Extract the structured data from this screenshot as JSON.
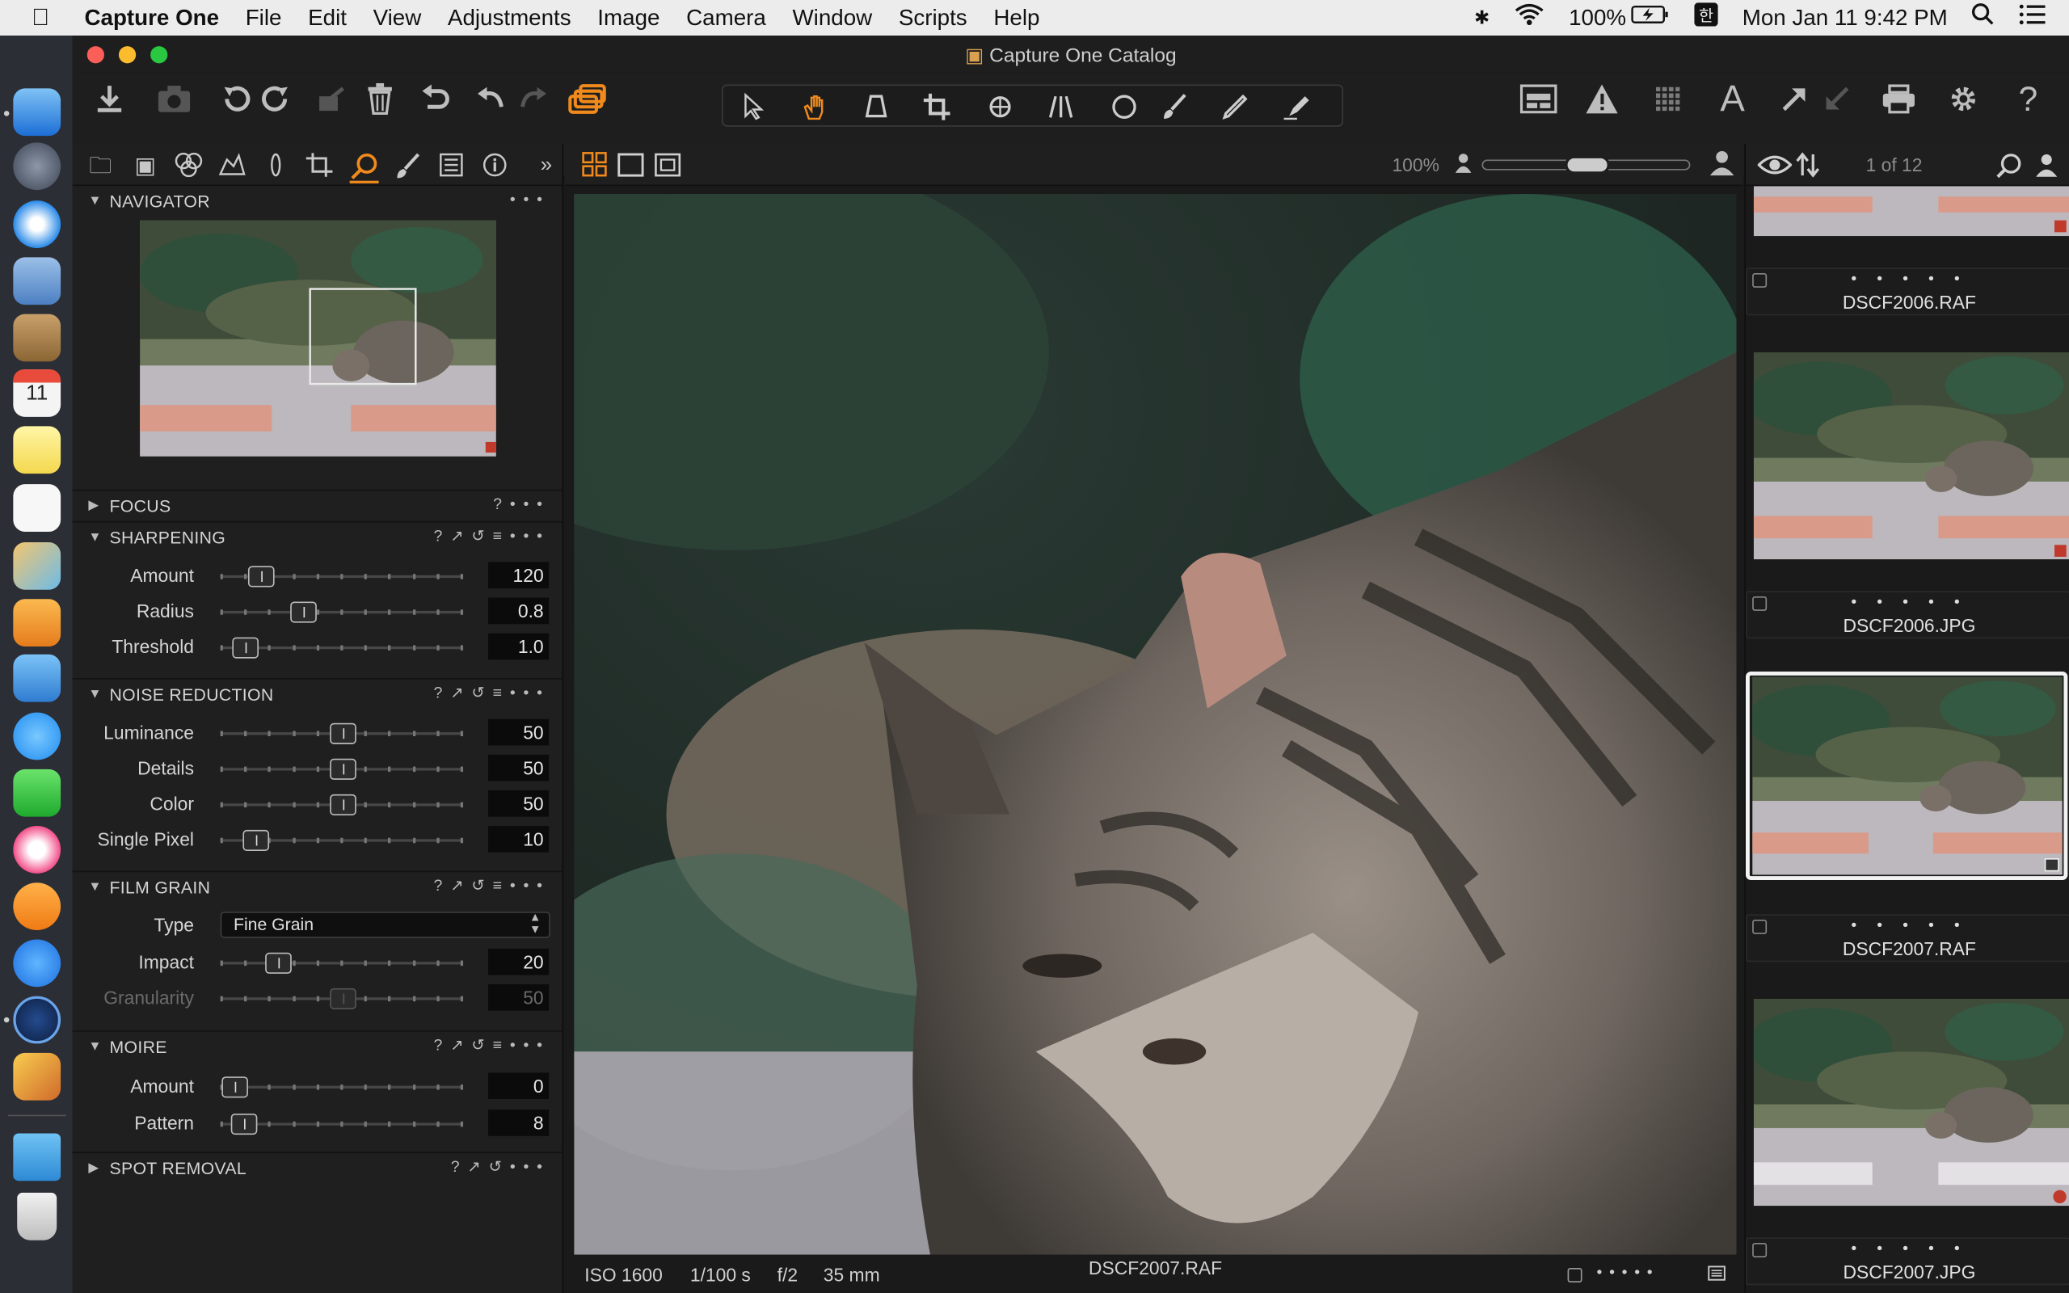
{
  "menubar": {
    "app_name": "Capture One",
    "items": [
      "File",
      "Edit",
      "View",
      "Adjustments",
      "Image",
      "Camera",
      "Window",
      "Scripts",
      "Help"
    ],
    "battery": "100%",
    "clock": "Mon Jan 11  9:42 PM"
  },
  "window": {
    "title": "Capture One Catalog"
  },
  "navigator": {
    "title": "NAVIGATOR"
  },
  "focus": {
    "title": "FOCUS"
  },
  "sharpening": {
    "title": "SHARPENING",
    "rows": [
      {
        "label": "Amount",
        "value": "120"
      },
      {
        "label": "Radius",
        "value": "0.8"
      },
      {
        "label": "Threshold",
        "value": "1.0"
      }
    ]
  },
  "noise": {
    "title": "NOISE REDUCTION",
    "rows": [
      {
        "label": "Luminance",
        "value": "50"
      },
      {
        "label": "Details",
        "value": "50"
      },
      {
        "label": "Color",
        "value": "50"
      },
      {
        "label": "Single Pixel",
        "value": "10"
      }
    ]
  },
  "grain": {
    "title": "FILM GRAIN",
    "type_label": "Type",
    "type_value": "Fine Grain",
    "rows": [
      {
        "label": "Impact",
        "value": "20"
      },
      {
        "label": "Granularity",
        "value": "50"
      }
    ]
  },
  "moire": {
    "title": "MOIRE",
    "rows": [
      {
        "label": "Amount",
        "value": "0"
      },
      {
        "label": "Pattern",
        "value": "8"
      }
    ]
  },
  "spot": {
    "title": "SPOT REMOVAL"
  },
  "viewer": {
    "zoom": "100%",
    "iso": "ISO 1600",
    "shutter": "1/100 s",
    "aperture": "f/2",
    "focal": "35 mm",
    "filename": "DSCF2007.RAF"
  },
  "browser": {
    "counter": "1 of 12",
    "captions": [
      "DSCF2006.RAF",
      "DSCF2006.JPG",
      "DSCF2007.RAF",
      "DSCF2007.JPG"
    ],
    "stars": "• • • • •"
  },
  "colors": {
    "accent": "#f08a1c"
  }
}
